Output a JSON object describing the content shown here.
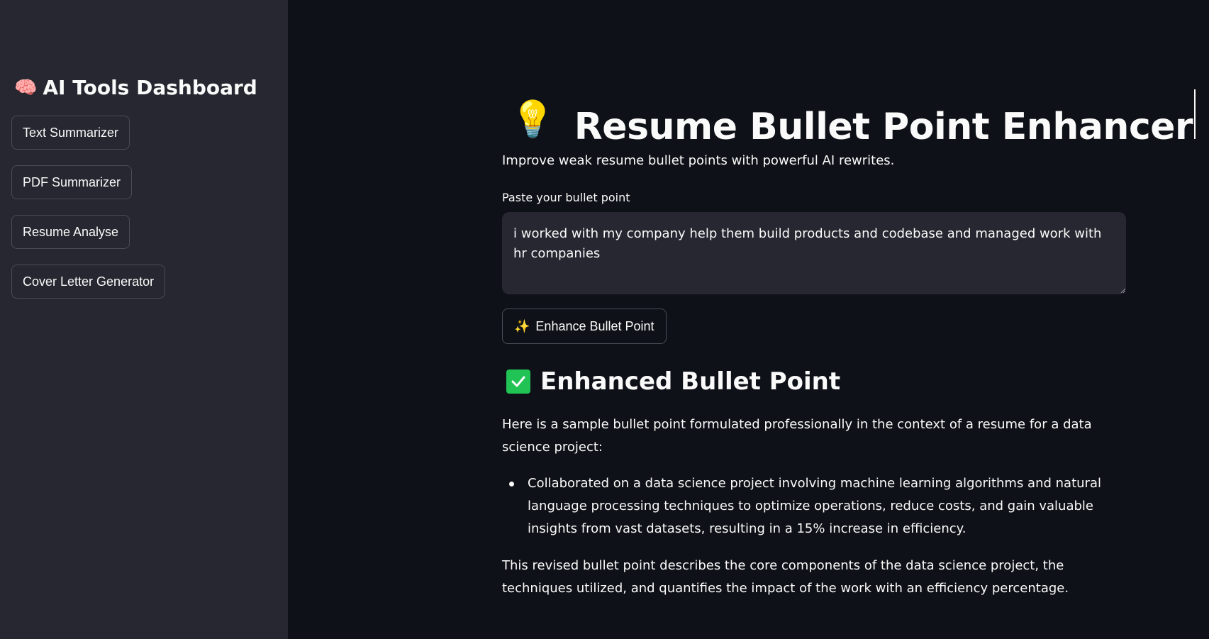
{
  "sidebar": {
    "title_emoji": "🧠",
    "title": "AI Tools Dashboard",
    "buttons": [
      {
        "label": "Text Summarizer"
      },
      {
        "label": "PDF Summarizer"
      },
      {
        "label": "Resume Analyse"
      },
      {
        "label": "Cover Letter Generator"
      }
    ]
  },
  "main": {
    "title_emoji": "💡",
    "title": "Resume Bullet Point Enhancer",
    "subtitle": "Improve weak resume bullet points with powerful AI rewrites.",
    "input_label": "Paste your bullet point",
    "input_value": "i worked with my company help them build products and codebase and managed work with hr companies",
    "enhance_button": {
      "icon": "✨",
      "label": "Enhance Bullet Point"
    },
    "result": {
      "heading": "Enhanced Bullet Point",
      "intro": "Here is a sample bullet point formulated professionally in the context of a resume for a data science project:",
      "bullets": [
        "Collaborated on a data science project involving machine learning algorithms and natural language processing techniques to optimize operations, reduce costs, and gain valuable insights from vast datasets, resulting in a 15% increase in efficiency."
      ],
      "outro": "This revised bullet point describes the core components of the data science project, the techniques utilized, and quantifies the impact of the work with an efficiency percentage."
    }
  },
  "colors": {
    "background": "#0e1117",
    "sidebar": "#262730",
    "input_bg": "#262730",
    "success": "#21c354",
    "text": "#fafafa"
  }
}
